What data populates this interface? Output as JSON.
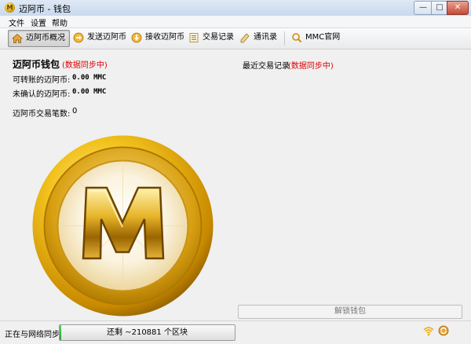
{
  "window": {
    "title": "迈阿币 - 钱包",
    "app_icon_letter": "M",
    "minimize_glyph": "—",
    "maximize_glyph": "□",
    "close_glyph": "✕"
  },
  "menu": {
    "items": [
      "文件",
      "设置",
      "帮助"
    ]
  },
  "toolbar": {
    "overview": {
      "label": "迈阿币概况",
      "icon": "home-icon"
    },
    "send": {
      "label": "发送迈阿币",
      "icon": "send-arrow-icon"
    },
    "receive": {
      "label": "接收迈阿币",
      "icon": "receive-arrow-icon"
    },
    "transactions": {
      "label": "交易记录",
      "icon": "ledger-icon"
    },
    "addressbook": {
      "label": "通讯录",
      "icon": "addressbook-icon"
    },
    "website": {
      "label": "MMC官网",
      "icon": "search-icon"
    }
  },
  "wallet": {
    "title": "迈阿币钱包",
    "sync_status": "(数据同步中)",
    "balance_label": "可转账的迈阿币:",
    "balance_value": "0.00 MMC",
    "unconfirmed_label": "未确认的迈阿币:",
    "unconfirmed_value": "0.00 MMC",
    "tx_count_label": "迈阿币交易笔数:",
    "tx_count_value": "0"
  },
  "recent": {
    "title": "最近交易记录",
    "sync_status": "(数据同步中)"
  },
  "logo": {
    "letter": "M",
    "colors": {
      "gold": "#f2c21d",
      "dark": "#b37800"
    }
  },
  "unlock_button": {
    "label": "解锁钱包"
  },
  "status": {
    "sync_text": "正在与网络同步...",
    "progress_text": "还剩 ~210881 个区块",
    "progress_fraction": 0.01
  },
  "colors": {
    "sync_red": "#e00000"
  }
}
